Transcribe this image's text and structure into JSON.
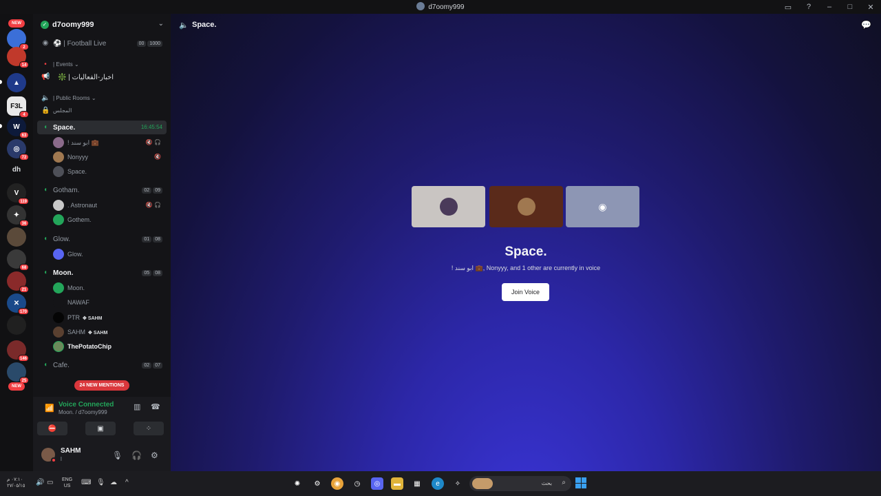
{
  "window": {
    "title": "d7oomy999"
  },
  "rail": {
    "new_label": "NEW",
    "badges": [
      "2",
      "14",
      "4",
      "63",
      "72",
      "119",
      "36",
      "68",
      "21",
      "170",
      "146",
      "25"
    ],
    "text_server": "dh"
  },
  "guild": {
    "name": "d7oomy999"
  },
  "channels": {
    "football": {
      "label": "Football Live",
      "count_a": "00",
      "count_b": "1000"
    },
    "events": {
      "label": "Events"
    },
    "news": {
      "label": "اخبار-الفعاليات"
    },
    "public_rooms": {
      "label": "Public Rooms"
    },
    "majlis": {
      "label": "المجلس"
    },
    "space": {
      "label": "Space.",
      "timer": "16:45:54"
    },
    "gotham": {
      "label": "Gotham.",
      "count_a": "02",
      "count_b": "09"
    },
    "glow": {
      "label": "Glow.",
      "count_a": "01",
      "count_b": "08"
    },
    "moon": {
      "label": "Moon.",
      "count_a": "05",
      "count_b": "08"
    },
    "cafe": {
      "label": "Cafe.",
      "count_a": "02",
      "count_b": "07"
    }
  },
  "voice_users": {
    "space": [
      "! ابو سند 💼",
      "Nonyyy",
      "Space."
    ],
    "gotham": [
      ". Astronaut",
      "Gothem."
    ],
    "glow": [
      "Glow."
    ],
    "moon": [
      "Moon.",
      "NAWAF",
      "PTR",
      "SAHM",
      "ThePotatoChip"
    ],
    "tag": "SAHM"
  },
  "mentions": "24 NEW MENTIONS",
  "voice_panel": {
    "status": "Voice Connected",
    "sub": "Moon. / d7oomy999"
  },
  "user": {
    "name": "SAHM",
    "sub": "l"
  },
  "main": {
    "header_title": "Space.",
    "vc_title": "Space.",
    "vc_sub": "! ابو سند 💼, Nonyyy, and 1 other are currently in voice",
    "join_label": "Join Voice"
  },
  "taskbar": {
    "time": "٠٧:١٠ م",
    "date": "٢٧/٠٥/١٥",
    "lang": "ENG",
    "region": "US",
    "search_placeholder": "بحث"
  },
  "colors": {
    "green": "#23a55a",
    "red": "#f23f43",
    "blurple": "#5865f2"
  }
}
